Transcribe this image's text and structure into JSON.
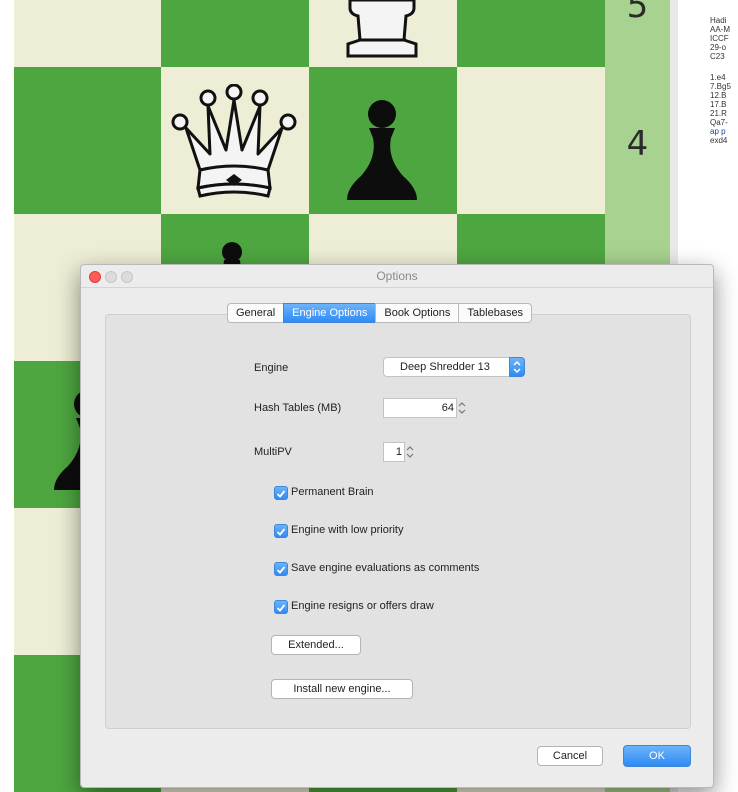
{
  "board": {
    "rank_label": "4",
    "colors": {
      "light": "#eeeed6",
      "dark": "#4ea640",
      "rank_strip": "#a7d28f"
    }
  },
  "notation": {
    "header_lines": [
      "Hadi",
      "AA-M",
      "ICCF",
      "29-o",
      "C23"
    ],
    "move_lines": [
      "1.e4",
      "7.Bg5",
      "12.B",
      "17.B",
      "21.R",
      "Qa7-",
      "ap p",
      "exd4"
    ]
  },
  "dialog": {
    "title": "Options",
    "tabs": [
      {
        "label": "General",
        "active": false
      },
      {
        "label": "Engine Options",
        "active": true
      },
      {
        "label": "Book Options",
        "active": false
      },
      {
        "label": "Tablebases",
        "active": false
      }
    ],
    "engine": {
      "label": "Engine",
      "value": "Deep Shredder 13"
    },
    "hash_tables": {
      "label": "Hash Tables (MB)",
      "value": "64"
    },
    "multipv": {
      "label": "MultiPV",
      "value": "1"
    },
    "checkboxes": [
      {
        "label": "Permanent Brain",
        "checked": true
      },
      {
        "label": "Engine with low priority",
        "checked": true
      },
      {
        "label": "Save engine evaluations as comments",
        "checked": true
      },
      {
        "label": "Engine resigns or offers draw",
        "checked": true
      }
    ],
    "extended_button": "Extended...",
    "install_button": "Install new engine...",
    "cancel_button": "Cancel",
    "ok_button": "OK",
    "accent_color": "#2f8bf5"
  }
}
